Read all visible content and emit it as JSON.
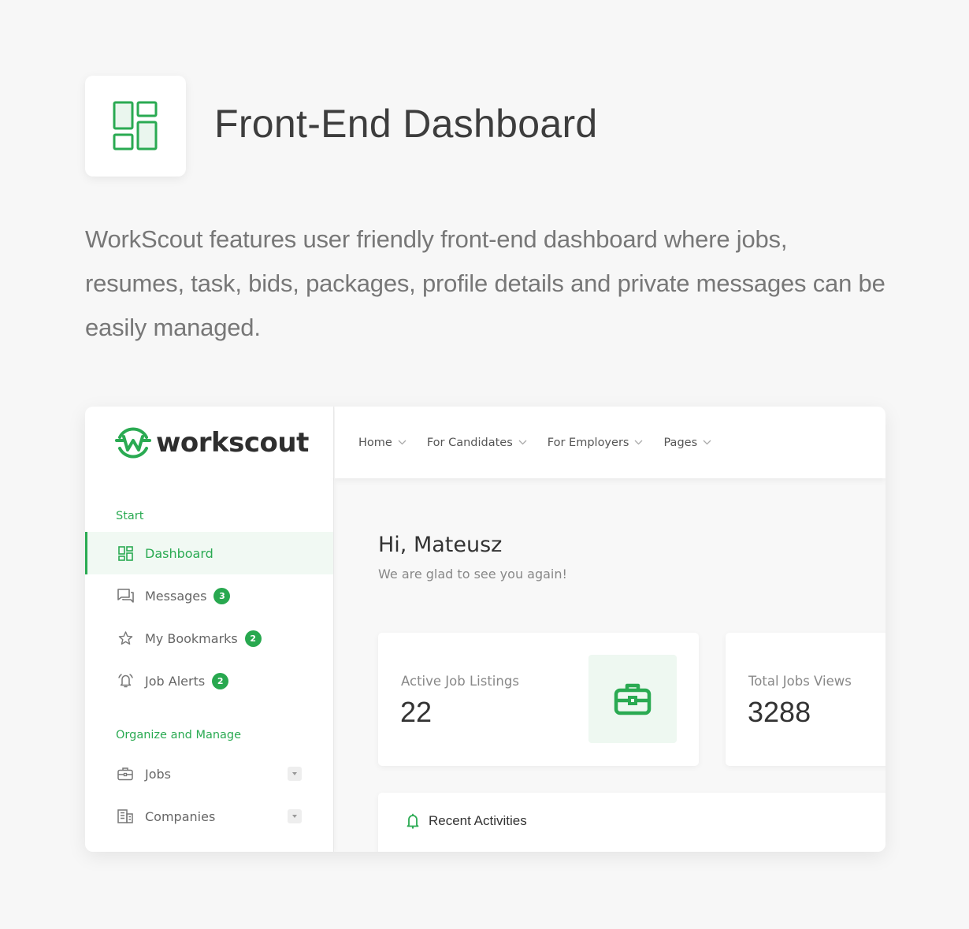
{
  "feature": {
    "icon": "dashboard-layout-icon",
    "title": "Front-End Dashboard",
    "description": "WorkScout features user friendly front-end dashboard where jobs, resumes, task, bids, packages, profile details and private messages can be easily managed."
  },
  "app": {
    "logo_text": "workscout",
    "logo_icon": "workscout-w-logo",
    "accent_color": "#2aaa52"
  },
  "topnav": {
    "items": [
      {
        "label": "Home",
        "icon": "chevron-down-icon"
      },
      {
        "label": "For Candidates",
        "icon": "chevron-down-icon"
      },
      {
        "label": "For Employers",
        "icon": "chevron-down-icon"
      },
      {
        "label": "Pages",
        "icon": "chevron-down-icon"
      }
    ]
  },
  "sidebar": {
    "sections": [
      {
        "heading": "Start",
        "items": [
          {
            "label": "Dashboard",
            "icon": "dashboard-icon",
            "active": true
          },
          {
            "label": "Messages",
            "icon": "messages-icon",
            "badge": "3"
          },
          {
            "label": "My Bookmarks",
            "icon": "star-icon",
            "badge": "2"
          },
          {
            "label": "Job Alerts",
            "icon": "bell-icon",
            "badge": "2"
          }
        ]
      },
      {
        "heading": "Organize and Manage",
        "items": [
          {
            "label": "Jobs",
            "icon": "briefcase-icon",
            "expandable": true
          },
          {
            "label": "Companies",
            "icon": "building-icon",
            "expandable": true
          }
        ]
      }
    ]
  },
  "main": {
    "greeting": "Hi, Mateusz",
    "subgreeting": "We are glad to see you again!",
    "stats": [
      {
        "label": "Active Job Listings",
        "value": "22",
        "icon": "briefcase-icon"
      },
      {
        "label": "Total Jobs Views",
        "value": "3288"
      }
    ],
    "recent_activities": {
      "title": "Recent Activities",
      "icon": "bell-icon"
    }
  }
}
